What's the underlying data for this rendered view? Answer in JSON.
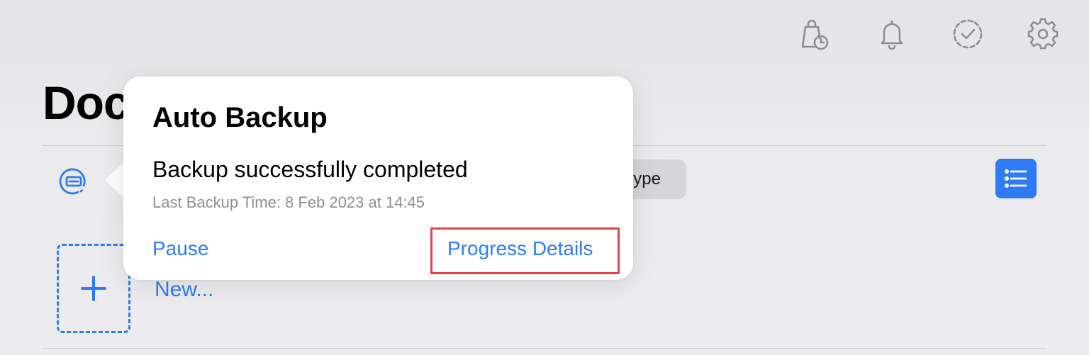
{
  "header": {
    "page_title": "Doc",
    "icons": [
      "backup-schedule-icon",
      "bell-icon",
      "checkmark-circle-icon",
      "gear-icon"
    ]
  },
  "toolbar": {
    "backup_status_icon": "backup-drive-icon",
    "sort_pill_label": "ype",
    "list_view_icon": "list-icon"
  },
  "content": {
    "new_label": "New..."
  },
  "popover": {
    "title": "Auto Backup",
    "message": "Backup successfully completed",
    "last_backup": "Last Backup Time: 8 Feb 2023 at 14:45",
    "pause_label": "Pause",
    "progress_details_label": "Progress Details"
  },
  "colors": {
    "accent": "#2f7bf5",
    "highlight": "#e0454f",
    "icon_gray": "#8e8e93"
  }
}
